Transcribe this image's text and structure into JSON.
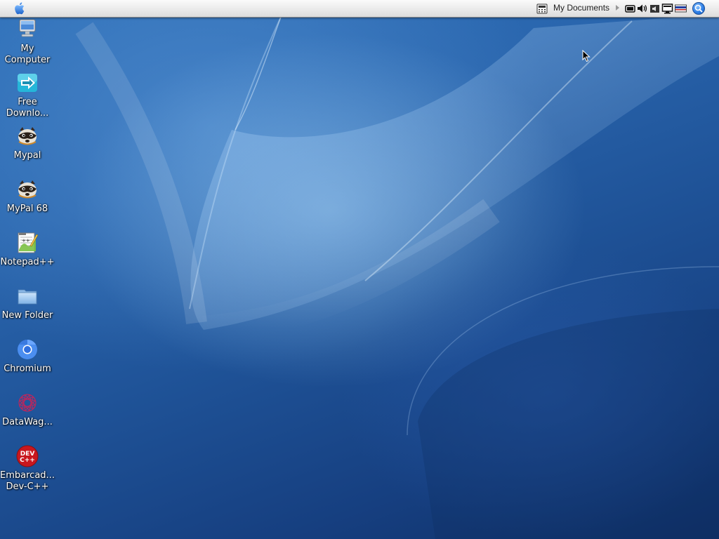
{
  "menubar": {
    "apple_icon": "apple-logo-icon",
    "location_label": "My Documents",
    "tray_icons": [
      "calculator-icon",
      "display-icon",
      "volume-icon",
      "speaker-icon",
      "monitor-icon",
      "keyboard-layout-icon",
      "search-icon"
    ]
  },
  "desktop": {
    "icons": [
      {
        "line1": "My",
        "line2": "Computer",
        "icon": "computer-icon"
      },
      {
        "line1": "Free",
        "line2": "Downlo...",
        "icon": "free-download-manager-icon"
      },
      {
        "line1": "Mypal",
        "line2": "",
        "icon": "mypal-raccoon-icon"
      },
      {
        "line1": "MyPal 68",
        "line2": "",
        "icon": "mypal68-raccoon-icon"
      },
      {
        "line1": "Notepad++",
        "line2": "",
        "icon": "notepadpp-icon"
      },
      {
        "line1": "New Folder",
        "line2": "",
        "icon": "folder-icon"
      },
      {
        "line1": "Chromium",
        "line2": "",
        "icon": "chromium-icon"
      },
      {
        "line1": "DataWag...",
        "line2": "",
        "icon": "datawagon-icon"
      },
      {
        "line1": "Embarcad...",
        "line2": "Dev-C++",
        "icon": "devcpp-icon",
        "badge_top": "DEV",
        "badge_bottom": "C++"
      }
    ]
  },
  "colors": {
    "wallpaper_base": "#1f5398",
    "menubar_bg": "#e9e9e9",
    "label_text": "#ffffff",
    "search_accent": "#2a7be4",
    "devcpp_red": "#c8171e"
  }
}
